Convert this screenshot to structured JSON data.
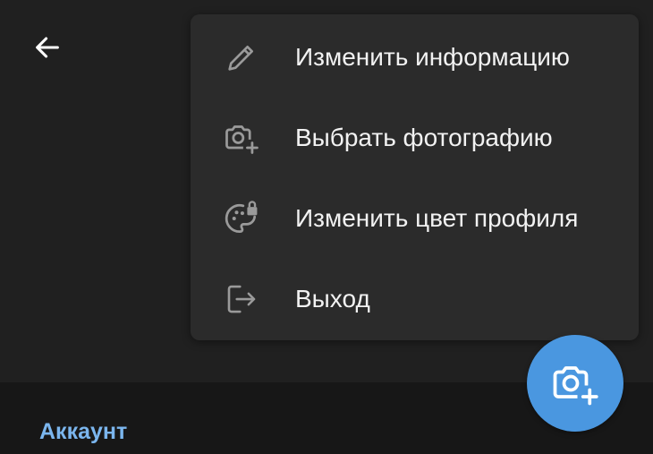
{
  "header": {
    "back_icon": "arrow-left-icon"
  },
  "menu": {
    "items": [
      {
        "label": "Изменить информацию",
        "icon": "pencil-icon"
      },
      {
        "label": "Выбрать фотографию",
        "icon": "camera-add-icon"
      },
      {
        "label": "Изменить цвет профиля",
        "icon": "palette-lock-icon"
      },
      {
        "label": "Выход",
        "icon": "logout-icon"
      }
    ]
  },
  "fab": {
    "icon": "camera-add-icon"
  },
  "section": {
    "title": "Аккаунт"
  },
  "colors": {
    "accent": "#4a97e0",
    "section_title": "#7bb6ee",
    "menu_bg": "#2b2b2b",
    "icon": "#9a9a9a"
  }
}
